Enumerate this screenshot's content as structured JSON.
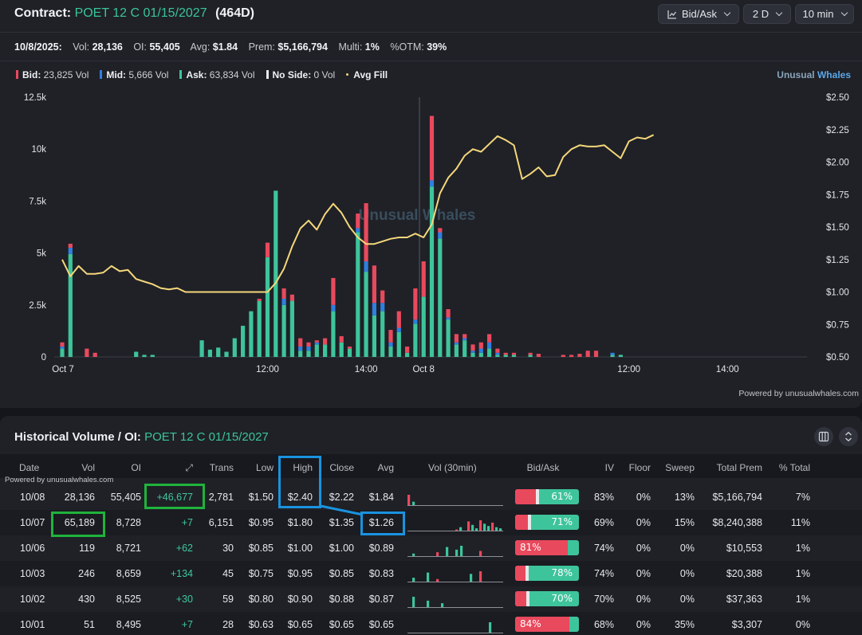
{
  "header": {
    "contract_label": "Contract:",
    "contract_name": "POET 12 C 01/15/2027",
    "dte": "(464D)",
    "chart_mode_label": "Bid/Ask",
    "range_label": "2 D",
    "interval_label": "10 min"
  },
  "stats": {
    "date": "10/8/2025:",
    "vol_label": "Vol:",
    "vol": "28,136",
    "oi_label": "OI:",
    "oi": "55,405",
    "avg_label": "Avg:",
    "avg": "$1.84",
    "prem_label": "Prem:",
    "prem": "$5,166,794",
    "multi_label": "Multi:",
    "multi": "1%",
    "otm_label": "%OTM:",
    "otm": "39%"
  },
  "legend": {
    "bid_label": "Bid:",
    "bid_vol": "23,825 Vol",
    "mid_label": "Mid:",
    "mid_vol": "5,666 Vol",
    "ask_label": "Ask:",
    "ask_vol": "63,834 Vol",
    "noside_label": "No Side:",
    "noside_vol": "0 Vol",
    "avgfill_label": "Avg Fill",
    "brand_a": "Unusual",
    "brand_b": "Whales"
  },
  "colors": {
    "bid": "#e9495d",
    "mid": "#2f7fe0",
    "ask": "#3ec49b",
    "avg_fill": "#f5d77a",
    "accent_green": "#3bc49a"
  },
  "chart_data": {
    "type": "bar",
    "watermark": "Unusual Whales",
    "left_axis": {
      "ticks": [
        "0",
        "2.5k",
        "5k",
        "7.5k",
        "10k",
        "12.5k"
      ],
      "ylim": [
        0,
        12500
      ]
    },
    "right_axis": {
      "ticks": [
        "$0.50",
        "$0.75",
        "$1.00",
        "$1.25",
        "$1.50",
        "$1.75",
        "$2.00",
        "$2.25",
        "$2.50"
      ],
      "ylim": [
        0.5,
        2.5
      ]
    },
    "x_labels": [
      {
        "label": "Oct 7",
        "t": 0
      },
      {
        "label": "12:00",
        "t": 25
      },
      {
        "label": "14:00",
        "t": 37
      },
      {
        "label": "Oct 8",
        "t": 44
      },
      {
        "label": "12:00",
        "t": 69
      },
      {
        "label": "14:00",
        "t": 81
      }
    ],
    "session_break_t": 43.5,
    "bars": [
      {
        "t": 0,
        "bid": 200,
        "mid": 100,
        "ask": 400
      },
      {
        "t": 1,
        "bid": 200,
        "mid": 300,
        "ask": 4950
      },
      {
        "t": 3,
        "bid": 400,
        "mid": 0,
        "ask": 0
      },
      {
        "t": 4,
        "bid": 200,
        "mid": 0,
        "ask": 0
      },
      {
        "t": 9,
        "bid": 0,
        "mid": 0,
        "ask": 250
      },
      {
        "t": 10,
        "bid": 0,
        "mid": 0,
        "ask": 100
      },
      {
        "t": 11,
        "bid": 0,
        "mid": 0,
        "ask": 100
      },
      {
        "t": 17,
        "bid": 0,
        "mid": 0,
        "ask": 800
      },
      {
        "t": 18,
        "bid": 0,
        "mid": 0,
        "ask": 350
      },
      {
        "t": 19,
        "bid": 0,
        "mid": 0,
        "ask": 450
      },
      {
        "t": 20,
        "bid": 0,
        "mid": 0,
        "ask": 250
      },
      {
        "t": 21,
        "bid": 0,
        "mid": 0,
        "ask": 900
      },
      {
        "t": 22,
        "bid": 0,
        "mid": 0,
        "ask": 1500
      },
      {
        "t": 23,
        "bid": 0,
        "mid": 0,
        "ask": 2200
      },
      {
        "t": 24,
        "bid": 100,
        "mid": 0,
        "ask": 2700
      },
      {
        "t": 25,
        "bid": 700,
        "mid": 0,
        "ask": 4800
      },
      {
        "t": 26,
        "bid": 0,
        "mid": 0,
        "ask": 8000
      },
      {
        "t": 27,
        "bid": 500,
        "mid": 300,
        "ask": 2500
      },
      {
        "t": 28,
        "bid": 300,
        "mid": 0,
        "ask": 2700
      },
      {
        "t": 29,
        "bid": 400,
        "mid": 200,
        "ask": 300
      },
      {
        "t": 30,
        "bid": 200,
        "mid": 200,
        "ask": 300
      },
      {
        "t": 31,
        "bid": 100,
        "mid": 100,
        "ask": 600
      },
      {
        "t": 32,
        "bid": 300,
        "mid": 0,
        "ask": 600
      },
      {
        "t": 33,
        "bid": 1300,
        "mid": 300,
        "ask": 2200
      },
      {
        "t": 34,
        "bid": 300,
        "mid": 0,
        "ask": 700
      },
      {
        "t": 35,
        "bid": 100,
        "mid": 0,
        "ask": 400
      },
      {
        "t": 36,
        "bid": 700,
        "mid": 200,
        "ask": 6000
      },
      {
        "t": 37,
        "bid": 2800,
        "mid": 500,
        "ask": 4100
      },
      {
        "t": 38,
        "bid": 1800,
        "mid": 600,
        "ask": 2000
      },
      {
        "t": 39,
        "bid": 600,
        "mid": 400,
        "ask": 2200
      },
      {
        "t": 40,
        "bid": 600,
        "mid": 200,
        "ask": 500
      },
      {
        "t": 41,
        "bid": 800,
        "mid": 200,
        "ask": 1200
      },
      {
        "t": 42,
        "bid": 300,
        "mid": 0,
        "ask": 200
      },
      {
        "t": 43,
        "bid": 1500,
        "mid": 200,
        "ask": 1600
      },
      {
        "t": 44,
        "bid": 1700,
        "mid": 0,
        "ask": 2900
      },
      {
        "t": 45,
        "bid": 3100,
        "mid": 300,
        "ask": 8200
      },
      {
        "t": 46,
        "bid": 200,
        "mid": 300,
        "ask": 5700
      },
      {
        "t": 47,
        "bid": 400,
        "mid": 100,
        "ask": 1800
      },
      {
        "t": 48,
        "bid": 400,
        "mid": 100,
        "ask": 600
      },
      {
        "t": 49,
        "bid": 200,
        "mid": 100,
        "ask": 800
      },
      {
        "t": 50,
        "bid": 300,
        "mid": 100,
        "ask": 200
      },
      {
        "t": 51,
        "bid": 300,
        "mid": 200,
        "ask": 200
      },
      {
        "t": 52,
        "bid": 400,
        "mid": 300,
        "ask": 400
      },
      {
        "t": 53,
        "bid": 200,
        "mid": 100,
        "ask": 100
      },
      {
        "t": 54,
        "bid": 100,
        "mid": 0,
        "ask": 100
      },
      {
        "t": 55,
        "bid": 100,
        "mid": 0,
        "ask": 100
      },
      {
        "t": 57,
        "bid": 100,
        "mid": 0,
        "ask": 100
      },
      {
        "t": 58,
        "bid": 150,
        "mid": 0,
        "ask": 0
      },
      {
        "t": 61,
        "bid": 100,
        "mid": 0,
        "ask": 0
      },
      {
        "t": 62,
        "bid": 100,
        "mid": 0,
        "ask": 0
      },
      {
        "t": 63,
        "bid": 150,
        "mid": 0,
        "ask": 0
      },
      {
        "t": 64,
        "bid": 300,
        "mid": 0,
        "ask": 0
      },
      {
        "t": 65,
        "bid": 300,
        "mid": 0,
        "ask": 0
      },
      {
        "t": 67,
        "bid": 0,
        "mid": 100,
        "ask": 100
      },
      {
        "t": 68,
        "bid": 0,
        "mid": 0,
        "ask": 100
      }
    ],
    "avg_fill": [
      {
        "t": 0,
        "p": 1.25
      },
      {
        "t": 1,
        "p": 1.12
      },
      {
        "t": 2,
        "p": 1.2
      },
      {
        "t": 3,
        "p": 1.14
      },
      {
        "t": 4,
        "p": 1.14
      },
      {
        "t": 5,
        "p": 1.15
      },
      {
        "t": 6,
        "p": 1.2
      },
      {
        "t": 7,
        "p": 1.16
      },
      {
        "t": 8,
        "p": 1.17
      },
      {
        "t": 9,
        "p": 1.1
      },
      {
        "t": 10,
        "p": 1.08
      },
      {
        "t": 11,
        "p": 1.06
      },
      {
        "t": 12,
        "p": 1.03
      },
      {
        "t": 13,
        "p": 1.02
      },
      {
        "t": 14,
        "p": 1.03
      },
      {
        "t": 15,
        "p": 1.0
      },
      {
        "t": 16,
        "p": 1.0
      },
      {
        "t": 17,
        "p": 1.0
      },
      {
        "t": 18,
        "p": 1.0
      },
      {
        "t": 19,
        "p": 1.0
      },
      {
        "t": 20,
        "p": 1.0
      },
      {
        "t": 21,
        "p": 1.0
      },
      {
        "t": 22,
        "p": 1.0
      },
      {
        "t": 23,
        "p": 1.0
      },
      {
        "t": 24,
        "p": 1.0
      },
      {
        "t": 25,
        "p": 1.0
      },
      {
        "t": 26,
        "p": 1.07
      },
      {
        "t": 27,
        "p": 1.18
      },
      {
        "t": 28,
        "p": 1.35
      },
      {
        "t": 29,
        "p": 1.49
      },
      {
        "t": 30,
        "p": 1.55
      },
      {
        "t": 31,
        "p": 1.48
      },
      {
        "t": 32,
        "p": 1.6
      },
      {
        "t": 33,
        "p": 1.68
      },
      {
        "t": 34,
        "p": 1.61
      },
      {
        "t": 35,
        "p": 1.5
      },
      {
        "t": 36,
        "p": 1.42
      },
      {
        "t": 37,
        "p": 1.37
      },
      {
        "t": 38,
        "p": 1.37
      },
      {
        "t": 39,
        "p": 1.39
      },
      {
        "t": 40,
        "p": 1.41
      },
      {
        "t": 41,
        "p": 1.42
      },
      {
        "t": 42,
        "p": 1.42
      },
      {
        "t": 43,
        "p": 1.45
      },
      {
        "t": 44,
        "p": 1.42
      },
      {
        "t": 45,
        "p": 1.52
      },
      {
        "t": 46,
        "p": 1.76
      },
      {
        "t": 47,
        "p": 1.88
      },
      {
        "t": 48,
        "p": 1.95
      },
      {
        "t": 49,
        "p": 2.05
      },
      {
        "t": 50,
        "p": 2.1
      },
      {
        "t": 51,
        "p": 2.08
      },
      {
        "t": 52,
        "p": 2.14
      },
      {
        "t": 53,
        "p": 2.2
      },
      {
        "t": 54,
        "p": 2.17
      },
      {
        "t": 55,
        "p": 2.13
      },
      {
        "t": 56,
        "p": 1.87
      },
      {
        "t": 57,
        "p": 1.91
      },
      {
        "t": 58,
        "p": 1.96
      },
      {
        "t": 59,
        "p": 1.89
      },
      {
        "t": 60,
        "p": 1.9
      },
      {
        "t": 61,
        "p": 2.04
      },
      {
        "t": 62,
        "p": 2.1
      },
      {
        "t": 63,
        "p": 2.13
      },
      {
        "t": 64,
        "p": 2.12
      },
      {
        "t": 65,
        "p": 2.12
      },
      {
        "t": 66,
        "p": 2.13
      },
      {
        "t": 67,
        "p": 2.08
      },
      {
        "t": 68,
        "p": 2.03
      },
      {
        "t": 69,
        "p": 2.16
      },
      {
        "t": 70,
        "p": 2.19
      },
      {
        "t": 71,
        "p": 2.18
      },
      {
        "t": 72,
        "p": 2.21
      }
    ]
  },
  "powered_top": "Powered by unusualwhales.com",
  "history": {
    "title": "Historical Volume / OI:",
    "contract": "POET 12 C 01/15/2027",
    "powered": "Powered by unusualwhales.com",
    "columns": [
      "Date",
      "Vol",
      "OI",
      "⤢",
      "Trans",
      "Low",
      "High",
      "Close",
      "Avg",
      "Vol (30min)",
      "Bid/Ask",
      "IV",
      "Floor",
      "Sweep",
      "Total Prem",
      "% Total"
    ],
    "rows": [
      {
        "date": "10/08",
        "vol": "28,136",
        "oi": "55,405",
        "chg": "+46,677",
        "trans": "2,781",
        "low": "$1.50",
        "high": "$2.40",
        "close": "$2.22",
        "avg": "$1.84",
        "ba_pct": "61%",
        "bid_frac": 0.32,
        "iv": "83%",
        "floor": "0%",
        "sweep": "13%",
        "prem": "$5,166,794",
        "pct_total": "7%",
        "spark": [
          6,
          2,
          0,
          0,
          0,
          0,
          0,
          0,
          0,
          0,
          0,
          0,
          0,
          0,
          0,
          0,
          0,
          0,
          0,
          0
        ]
      },
      {
        "date": "10/07",
        "vol": "65,189",
        "oi": "8,728",
        "chg": "+7",
        "trans": "6,151",
        "low": "$0.95",
        "high": "$1.80",
        "close": "$1.35",
        "avg": "$1.26",
        "ba_pct": "71%",
        "bid_frac": 0.2,
        "iv": "69%",
        "floor": "0%",
        "sweep": "15%",
        "prem": "$8,240,388",
        "pct_total": "11%",
        "spark": [
          0,
          0,
          0,
          0,
          0,
          0,
          0,
          0,
          0,
          0,
          0,
          0,
          1,
          3,
          0,
          8,
          5,
          2,
          9,
          6,
          4,
          7,
          3,
          2
        ]
      },
      {
        "date": "10/06",
        "vol": "119",
        "oi": "8,721",
        "chg": "+62",
        "trans": "30",
        "low": "$0.85",
        "high": "$1.00",
        "close": "$1.00",
        "avg": "$0.89",
        "ba_pct": "81%",
        "bid_frac": 0.82,
        "iv": "74%",
        "floor": "0%",
        "sweep": "0%",
        "prem": "$10,553",
        "pct_total": "1%",
        "spark": [
          0,
          2,
          0,
          0,
          0,
          0,
          3,
          0,
          7,
          0,
          5,
          8,
          0,
          0,
          0,
          4,
          0,
          0,
          0,
          0
        ]
      },
      {
        "date": "10/03",
        "vol": "246",
        "oi": "8,659",
        "chg": "+134",
        "trans": "45",
        "low": "$0.75",
        "high": "$0.95",
        "close": "$0.85",
        "avg": "$0.83",
        "ba_pct": "78%",
        "bid_frac": 0.16,
        "iv": "74%",
        "floor": "0%",
        "sweep": "0%",
        "prem": "$20,388",
        "pct_total": "1%",
        "spark": [
          0,
          3,
          0,
          0,
          7,
          0,
          2,
          0,
          0,
          0,
          0,
          0,
          0,
          6,
          0,
          8,
          0,
          0,
          0,
          0
        ]
      },
      {
        "date": "10/02",
        "vol": "430",
        "oi": "8,525",
        "chg": "+30",
        "trans": "59",
        "low": "$0.80",
        "high": "$0.90",
        "close": "$0.88",
        "avg": "$0.87",
        "ba_pct": "70%",
        "bid_frac": 0.18,
        "iv": "70%",
        "floor": "0%",
        "sweep": "0%",
        "prem": "$37,363",
        "pct_total": "1%",
        "spark": [
          0,
          8,
          0,
          0,
          5,
          0,
          0,
          3,
          0,
          0,
          0,
          0,
          0,
          0,
          0,
          0,
          0,
          0,
          0,
          0
        ]
      },
      {
        "date": "10/01",
        "vol": "51",
        "oi": "8,495",
        "chg": "+7",
        "trans": "28",
        "low": "$0.63",
        "high": "$0.65",
        "close": "$0.65",
        "avg": "$0.65",
        "ba_pct": "84%",
        "bid_frac": 0.85,
        "iv": "68%",
        "floor": "0%",
        "sweep": "35%",
        "prem": "$3,307",
        "pct_total": "0%",
        "spark": [
          0,
          0,
          0,
          0,
          0,
          0,
          0,
          0,
          0,
          0,
          0,
          0,
          0,
          0,
          0,
          0,
          0,
          8,
          0,
          0
        ]
      }
    ]
  }
}
